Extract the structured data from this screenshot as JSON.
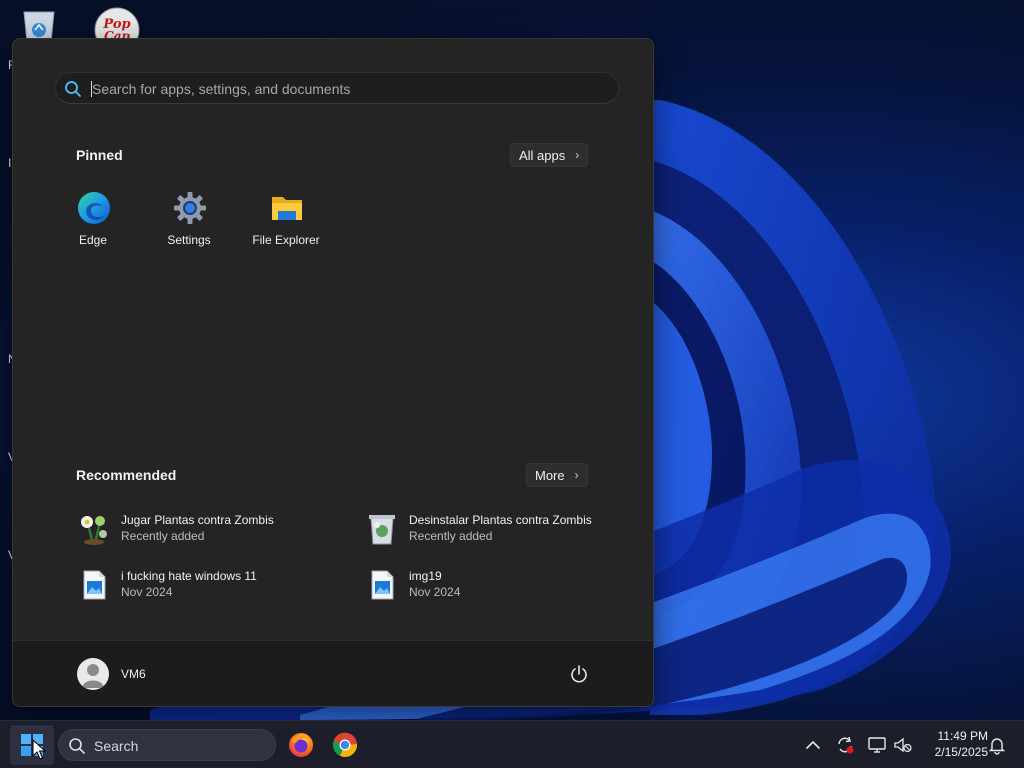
{
  "desktop": {
    "edge_letters": [
      "R",
      "I",
      "N",
      "V",
      "V"
    ]
  },
  "start_menu": {
    "search_placeholder": "Search for apps, settings, and documents",
    "pinned": {
      "title": "Pinned",
      "all_apps_label": "All apps",
      "apps": [
        {
          "label": "Edge",
          "icon": "edge-icon"
        },
        {
          "label": "Settings",
          "icon": "settings-gear-icon"
        },
        {
          "label": "File Explorer",
          "icon": "folder-icon"
        }
      ]
    },
    "recommended": {
      "title": "Recommended",
      "more_label": "More",
      "items": [
        {
          "name": "Jugar Plantas contra Zombis",
          "sub": "Recently added",
          "icon": "plants-vs-zombies-icon"
        },
        {
          "name": "Desinstalar Plantas contra Zombis",
          "sub": "Recently added",
          "icon": "uninstall-icon"
        },
        {
          "name": "i fucking hate windows 11",
          "sub": "Nov 2024",
          "icon": "image-file-icon"
        },
        {
          "name": "img19",
          "sub": "Nov 2024",
          "icon": "image-file-icon"
        }
      ]
    },
    "user": {
      "name": "VM6"
    }
  },
  "taskbar": {
    "search_label": "Search",
    "apps": [
      "firefox-icon",
      "chrome-icon"
    ],
    "clock": {
      "time": "11:49 PM",
      "date": "2/15/2025"
    }
  },
  "colors": {
    "menu_bg": "#242424",
    "footer_bg": "#1c1c1c",
    "accent": "#4cc2ff",
    "taskbar_bg": "#1c1f2a"
  }
}
